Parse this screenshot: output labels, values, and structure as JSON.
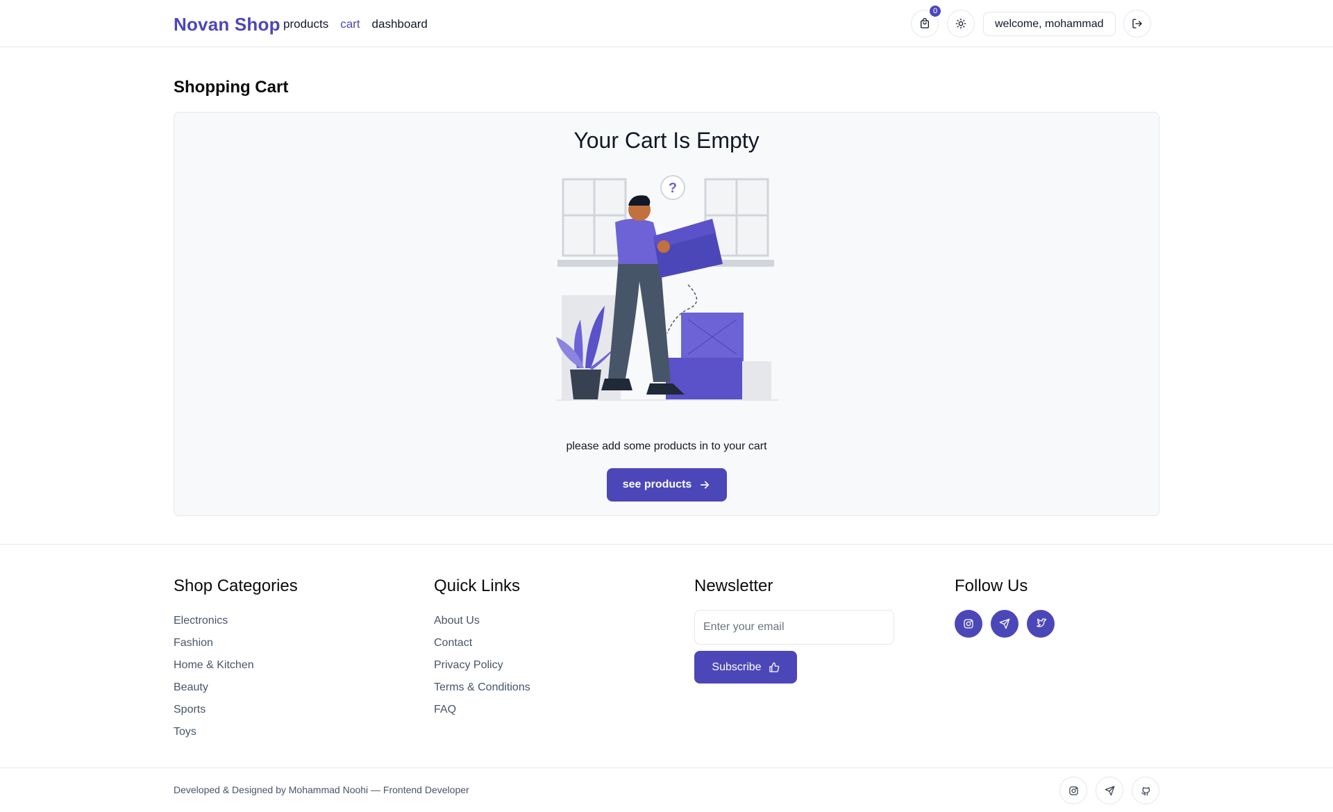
{
  "header": {
    "brand": "Novan Shop",
    "nav": [
      {
        "label": "products",
        "active": false
      },
      {
        "label": "cart",
        "active": true
      },
      {
        "label": "dashboard",
        "active": false
      }
    ],
    "cart_count": "0",
    "welcome": "welcome, mohammad",
    "icons": [
      "shopping-bag-icon",
      "sun-icon",
      "logout-icon"
    ]
  },
  "main": {
    "title": "Shopping Cart",
    "empty_title": "Your Cart Is Empty",
    "empty_message": "please add some products in to your cart",
    "cta_label": "see products"
  },
  "footer": {
    "categories": {
      "heading": "Shop Categories",
      "items": [
        "Electronics",
        "Fashion",
        "Home & Kitchen",
        "Beauty",
        "Sports",
        "Toys"
      ]
    },
    "quick_links": {
      "heading": "Quick Links",
      "items": [
        "About Us",
        "Contact",
        "Privacy Policy",
        "Terms & Conditions",
        "FAQ"
      ]
    },
    "newsletter": {
      "heading": "Newsletter",
      "placeholder": "Enter your email",
      "subscribe_label": "Subscribe"
    },
    "follow": {
      "heading": "Follow Us",
      "icons": [
        "instagram-icon",
        "telegram-icon",
        "twitter-icon"
      ]
    },
    "credits": "Developed & Designed by Mohammad Noohi — Frontend Developer",
    "bottom_icons": [
      "instagram-icon",
      "telegram-icon",
      "github-icon"
    ]
  },
  "colors": {
    "accent": "#4c47b8",
    "card_bg": "#f8f9fa",
    "border": "#e5e7eb"
  }
}
